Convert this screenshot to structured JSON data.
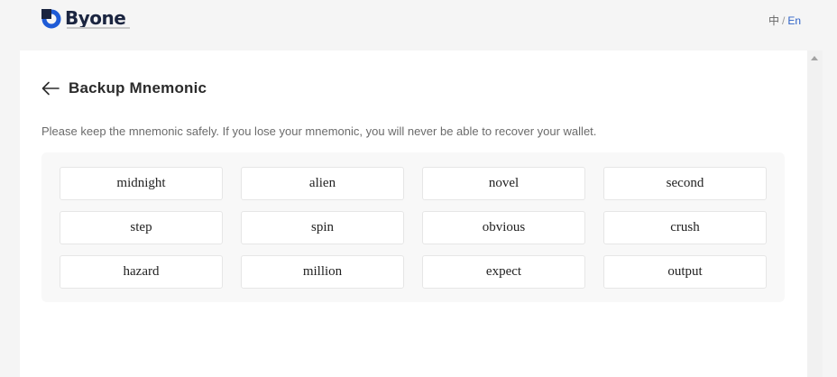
{
  "brand": {
    "name": "Byone",
    "accent": "#1e5bd6"
  },
  "language": {
    "zh": "中",
    "separator": "/",
    "en": "En",
    "active": "En"
  },
  "page": {
    "title": "Backup Mnemonic",
    "description": "Please keep the mnemonic safely. If you lose your mnemonic, you will never be able to recover your wallet."
  },
  "mnemonic": [
    "midnight",
    "alien",
    "novel",
    "second",
    "step",
    "spin",
    "obvious",
    "crush",
    "hazard",
    "million",
    "expect",
    "output"
  ],
  "icons": {
    "back": "arrow-left-icon",
    "logo": "byone-logo-icon",
    "scroll": "scroll-up-arrow-icon"
  }
}
